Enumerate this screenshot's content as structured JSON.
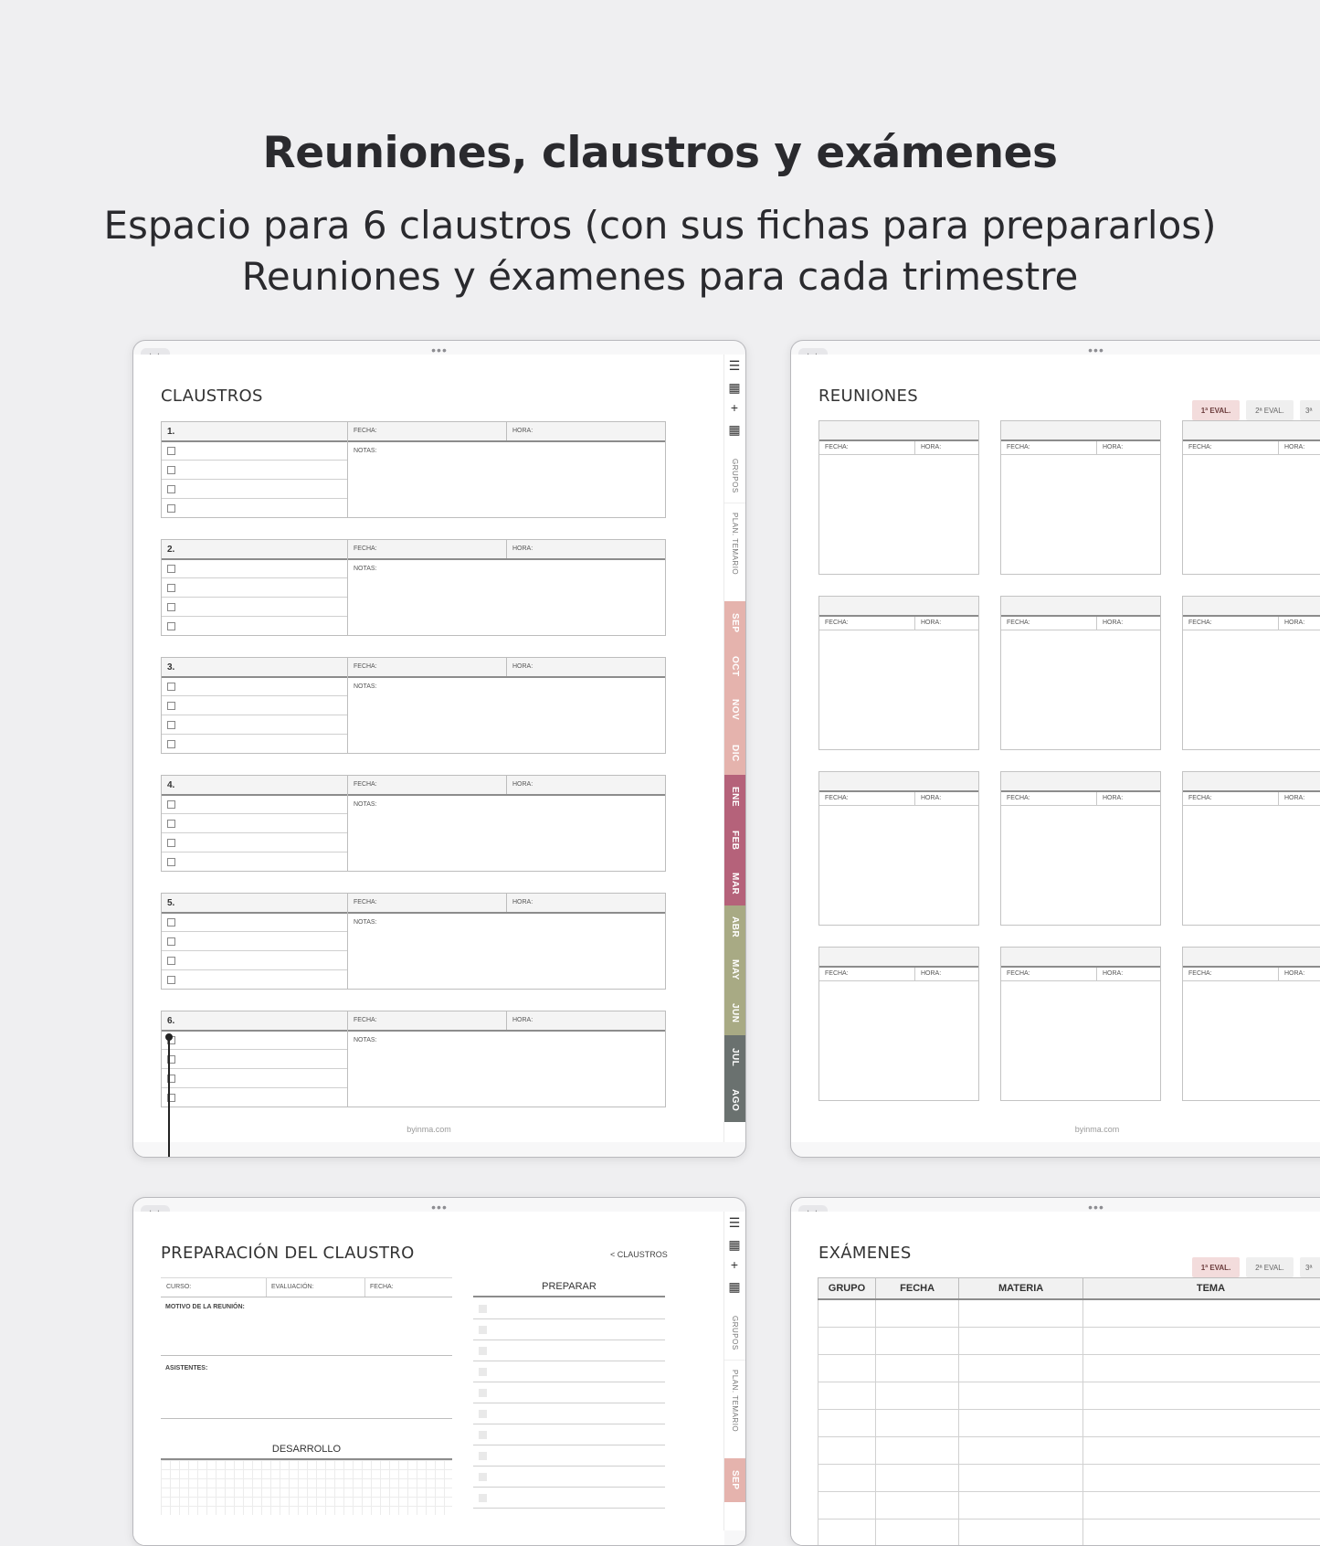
{
  "headline": "Reuniones, claustros y exámenes",
  "subline_1": "Espacio para 6 claustros (con sus fichas para prepararlos)",
  "subline_2": "Reuniones y éxamenes para cada trimestre",
  "common": {
    "menu_icon": "hamburger-menu-icon",
    "calendar_icon": "calendar-icon",
    "add_icon": "plus-icon",
    "calendar_add_icon": "calendar-add-icon",
    "footer": "byinma.com",
    "fecha": "FECHA:",
    "hora": "HORA:",
    "notas": "NOTAS:"
  },
  "tabs": {
    "grupos": "GRUPOS",
    "plan": "PLAN. TEMARIO",
    "months": [
      {
        "label": "SEP",
        "color": "#e5b3ad"
      },
      {
        "label": "OCT",
        "color": "#e5b3ad"
      },
      {
        "label": "NOV",
        "color": "#e5b3ad"
      },
      {
        "label": "DIC",
        "color": "#e5b3ad"
      },
      {
        "label": "ENE",
        "color": "#b5627a"
      },
      {
        "label": "FEB",
        "color": "#b5627a"
      },
      {
        "label": "MAR",
        "color": "#b5627a"
      },
      {
        "label": "ABR",
        "color": "#a8aa84"
      },
      {
        "label": "MAY",
        "color": "#a8aa84"
      },
      {
        "label": "JUN",
        "color": "#a8aa84"
      },
      {
        "label": "JUL",
        "color": "#6a716f"
      },
      {
        "label": "AGO",
        "color": "#6a716f"
      }
    ]
  },
  "claustros": {
    "title": "CLAUSTROS",
    "items": [
      "1.",
      "2.",
      "3.",
      "4.",
      "5.",
      "6."
    ]
  },
  "reuniones": {
    "title": "REUNIONES",
    "evals": [
      "1ª EVAL.",
      "2ª EVAL.",
      "3ª"
    ]
  },
  "preparacion": {
    "title": "PREPARACIÓN DEL CLAUSTRO",
    "back_link": "< CLAUSTROS",
    "curso": "CURSO:",
    "evaluacion": "EVALUACIÓN:",
    "fecha": "FECHA:",
    "motivo": "MOTIVO DE LA REUNIÓN:",
    "asistentes": "ASISTENTES:",
    "desarrollo": "DESARROLLO",
    "preparar": "PREPARAR"
  },
  "examenes": {
    "title": "EXÁMENES",
    "evals": [
      "1ª EVAL.",
      "2ª EVAL.",
      "3ª"
    ],
    "columns": [
      "GRUPO",
      "FECHA",
      "MATERIA",
      "TEMA"
    ]
  },
  "colors": {
    "eval_active": "#f3dcdc",
    "eval_inactive": "#efefef"
  }
}
